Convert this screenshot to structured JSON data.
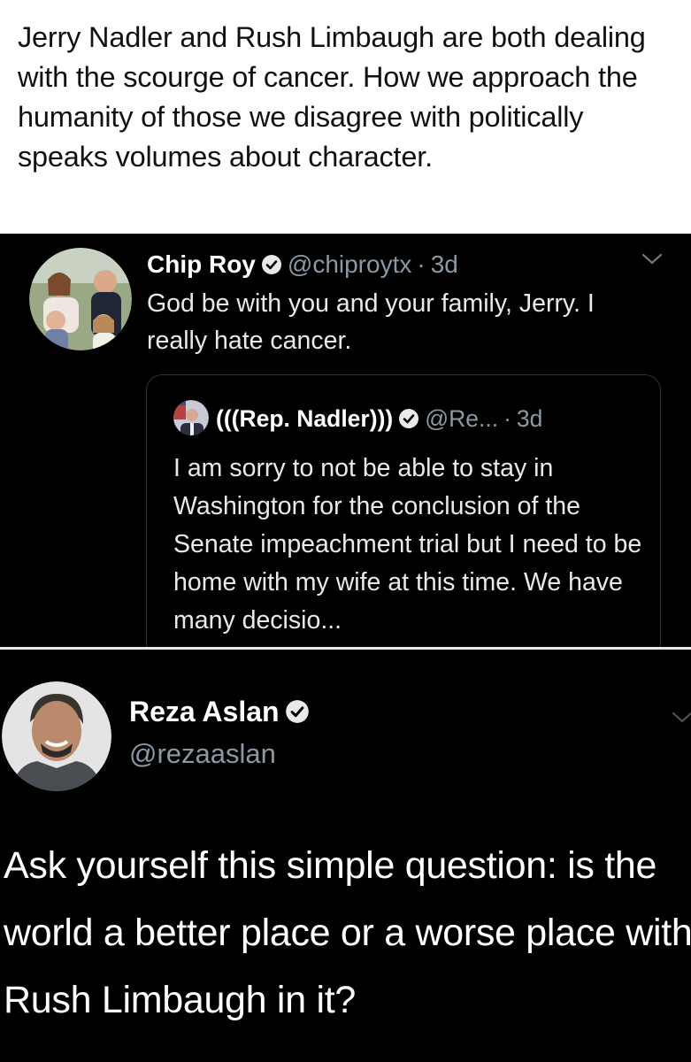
{
  "caption": {
    "text": "Jerry Nadler and Rush Limbaugh are both dealing with the scourge of cancer.  How we approach the humanity of those we disagree with politically speaks volumes about character."
  },
  "tweet1": {
    "author_name": "Chip Roy",
    "author_handle": "@chiproytx",
    "separator": "·",
    "time": "3d",
    "text": "God be with you and your family, Jerry.  I really hate cancer.",
    "quoted": {
      "author_name": "(((Rep. Nadler)))",
      "author_handle": "@Re...",
      "separator": "·",
      "time": "3d",
      "text": "I am sorry to not be able to stay in Washington for the conclusion of the Senate impeachment trial but I need to be home with my wife at this time. We have many decisio..."
    }
  },
  "tweet2": {
    "author_name": "Reza Aslan",
    "author_handle": "@rezaaslan",
    "text": "Ask yourself this simple question: is the world a better place or a worse place with Rush Limbaugh in it?"
  },
  "icons": {
    "verified": "verified-badge-icon",
    "more": "chevron-down-icon"
  },
  "colors": {
    "background": "#000000",
    "text": "#e7e9ea",
    "muted": "#8b98a5",
    "caption_bg": "#ffffff"
  }
}
